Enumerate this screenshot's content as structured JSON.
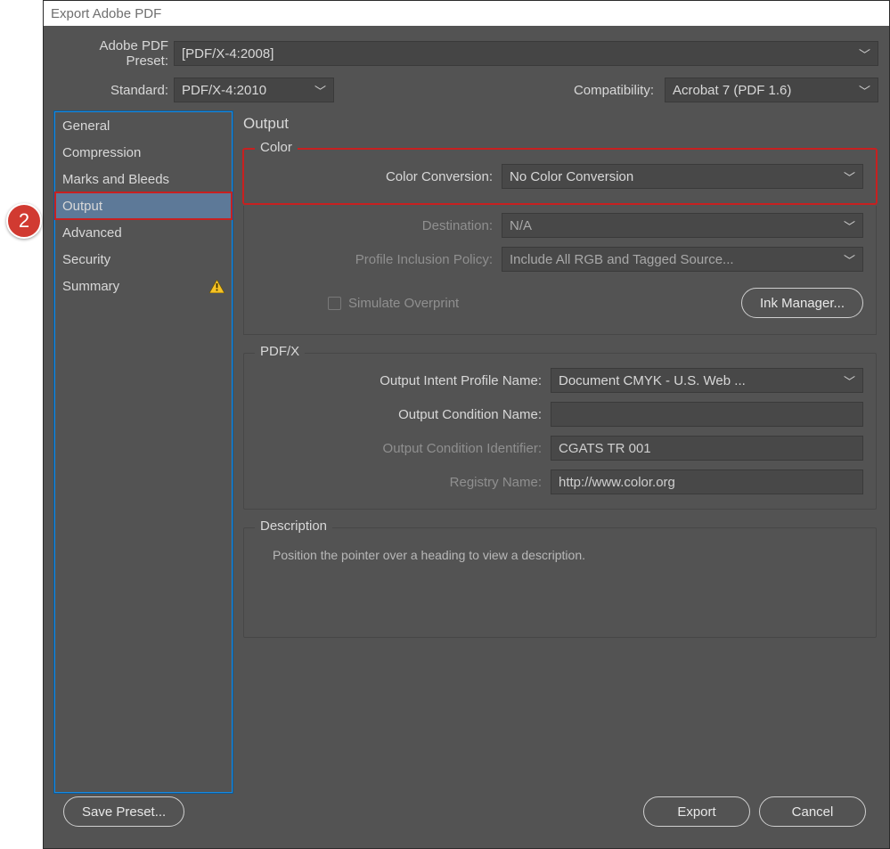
{
  "window": {
    "title": "Export Adobe PDF"
  },
  "top": {
    "preset_label": "Adobe PDF Preset:",
    "preset_value": "[PDF/X-4:2008]",
    "standard_label": "Standard:",
    "standard_value": "PDF/X-4:2010",
    "compat_label": "Compatibility:",
    "compat_value": "Acrobat 7 (PDF 1.6)"
  },
  "sidebar": {
    "items": [
      {
        "label": "General"
      },
      {
        "label": "Compression"
      },
      {
        "label": "Marks and Bleeds"
      },
      {
        "label": "Output"
      },
      {
        "label": "Advanced"
      },
      {
        "label": "Security"
      },
      {
        "label": "Summary"
      }
    ]
  },
  "main": {
    "title": "Output",
    "color": {
      "group_title": "Color",
      "conversion_label": "Color Conversion:",
      "conversion_value": "No Color Conversion",
      "destination_label": "Destination:",
      "destination_value": "N/A",
      "profile_label": "Profile Inclusion Policy:",
      "profile_value": "Include All RGB and Tagged Source...",
      "simulate_label": "Simulate Overprint",
      "ink_button": "Ink Manager..."
    },
    "pdfx": {
      "group_title": "PDF/X",
      "intent_label": "Output Intent Profile Name:",
      "intent_value": "Document CMYK - U.S. Web ...",
      "cond_name_label": "Output Condition Name:",
      "cond_name_value": "",
      "cond_id_label": "Output Condition Identifier:",
      "cond_id_value": "CGATS TR 001",
      "registry_label": "Registry Name:",
      "registry_value": "http://www.color.org"
    },
    "description": {
      "group_title": "Description",
      "text": "Position the pointer over a heading to view a description."
    }
  },
  "footer": {
    "save_preset": "Save Preset...",
    "export": "Export",
    "cancel": "Cancel"
  },
  "annotation": {
    "number": "2"
  }
}
